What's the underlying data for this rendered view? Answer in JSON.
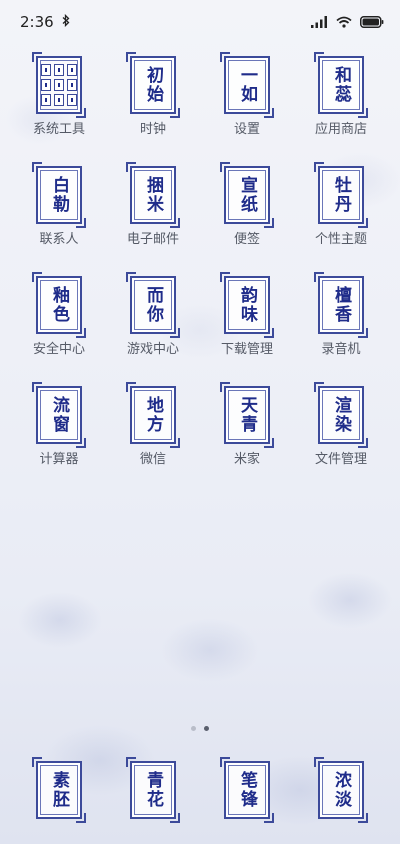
{
  "status": {
    "time": "2:36",
    "bluetooth_icon": "bluetooth-icon",
    "signal_icon": "signal-icon",
    "wifi_icon": "wifi-icon",
    "battery_icon": "battery-icon"
  },
  "apps": [
    {
      "label": "系统工具",
      "glyph": "",
      "folder": true
    },
    {
      "label": "时钟",
      "glyph": "初始"
    },
    {
      "label": "设置",
      "glyph": "一如"
    },
    {
      "label": "应用商店",
      "glyph": "和蕊"
    },
    {
      "label": "联系人",
      "glyph": "白勒"
    },
    {
      "label": "电子邮件",
      "glyph": "捆米"
    },
    {
      "label": "便签",
      "glyph": "宣纸"
    },
    {
      "label": "个性主题",
      "glyph": "牡丹"
    },
    {
      "label": "安全中心",
      "glyph": "釉色"
    },
    {
      "label": "游戏中心",
      "glyph": "而你"
    },
    {
      "label": "下载管理",
      "glyph": "韵味"
    },
    {
      "label": "录音机",
      "glyph": "檀香"
    },
    {
      "label": "计算器",
      "glyph": "流窗"
    },
    {
      "label": "微信",
      "glyph": "地方"
    },
    {
      "label": "米家",
      "glyph": "天青"
    },
    {
      "label": "文件管理",
      "glyph": "渲染"
    }
  ],
  "dock": [
    {
      "glyph": "素胚"
    },
    {
      "glyph": "青花"
    },
    {
      "glyph": "笔锋"
    },
    {
      "glyph": "浓淡"
    }
  ],
  "page_indicator": {
    "pages": 2,
    "current": 2
  }
}
